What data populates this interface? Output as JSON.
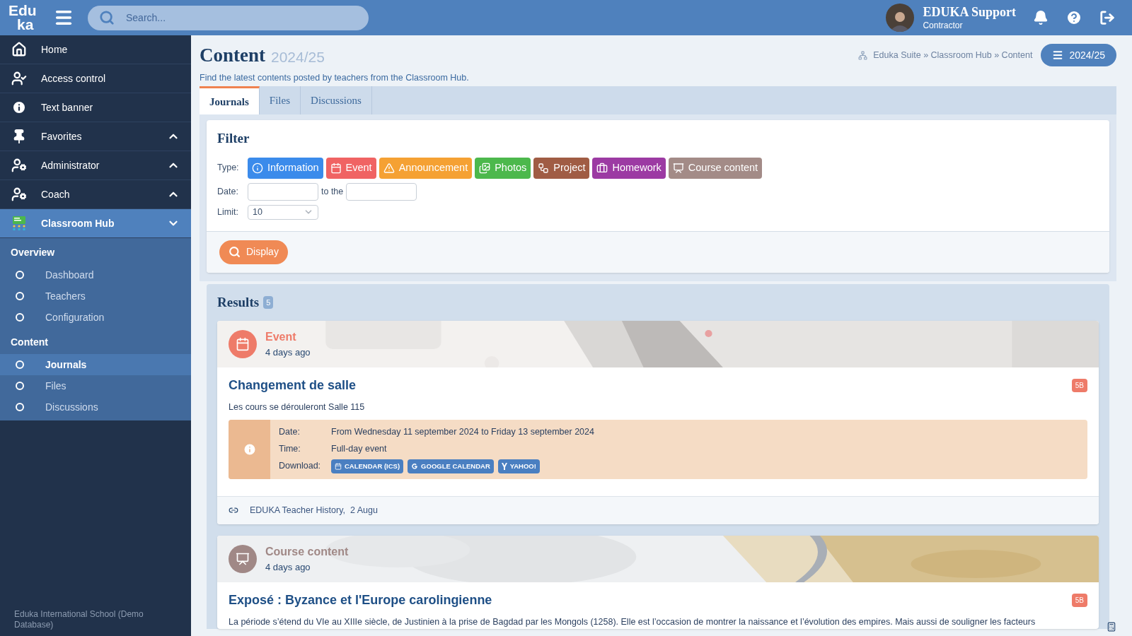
{
  "header": {
    "logo": [
      "Edu",
      "ka"
    ],
    "search": {
      "placeholder": "Search..."
    },
    "user": {
      "name": "EDUKA Support",
      "role": "Contractor"
    }
  },
  "sidebar": {
    "items": [
      {
        "kind": "link",
        "label": "Home",
        "selected": false
      },
      {
        "kind": "link",
        "label": "Access control",
        "selected": false
      },
      {
        "kind": "link",
        "label": "Text banner",
        "selected": false
      },
      {
        "kind": "group",
        "label": "Favorites",
        "expanded": false,
        "selected": false
      },
      {
        "kind": "group",
        "label": "Administrator",
        "expanded": false,
        "selected": false
      },
      {
        "kind": "group",
        "label": "Coach",
        "expanded": false,
        "selected": false
      },
      {
        "kind": "group",
        "label": "Classroom Hub",
        "expanded": true,
        "selected": true
      }
    ],
    "submenu": [
      {
        "heading": "Overview",
        "items": [
          {
            "label": "Dashboard",
            "selected": false
          },
          {
            "label": "Teachers",
            "selected": false
          },
          {
            "label": "Configuration",
            "selected": false
          }
        ]
      },
      {
        "heading": "Content",
        "items": [
          {
            "label": "Journals",
            "selected": true
          },
          {
            "label": "Files",
            "selected": false
          },
          {
            "label": "Discussions",
            "selected": false
          }
        ]
      }
    ],
    "footer": "Eduka International School (Demo Database)"
  },
  "page": {
    "title": "Content",
    "year": "2024/25",
    "breadcrumb": "Eduka Suite » Classroom Hub » Content",
    "year_button": "2024/25",
    "subtitle": "Find the latest contents posted by teachers from the Classroom Hub."
  },
  "tabs": [
    {
      "label": "Journals",
      "selected": true
    },
    {
      "label": "Files",
      "selected": false
    },
    {
      "label": "Discussions",
      "selected": false
    }
  ],
  "filter": {
    "title": "Filter",
    "type_label": "Type:",
    "types": [
      {
        "kind": "information",
        "label": "Information",
        "color": "#3b8beb"
      },
      {
        "kind": "event",
        "label": "Event",
        "color": "#f06363"
      },
      {
        "kind": "announcement",
        "label": "Announcement",
        "color": "#f5a133"
      },
      {
        "kind": "photos",
        "label": "Photos",
        "color": "#4cb84c"
      },
      {
        "kind": "project",
        "label": "Project",
        "color": "#a05c44"
      },
      {
        "kind": "homework",
        "label": "Homework",
        "color": "#9c3aa3"
      },
      {
        "kind": "course",
        "label": "Course content",
        "color": "#a38b87"
      }
    ],
    "date_label": "Date:",
    "to_label": "to the",
    "limit_label": "Limit:",
    "limit": "10",
    "button": "Display"
  },
  "results": {
    "title": "Results",
    "count": "5",
    "posts": [
      {
        "kind": "event",
        "type_label": "Event",
        "color": "#ee7b69",
        "time": "4 days ago",
        "title": "Changement de salle",
        "badge": "5B",
        "body": "Les cours se dérouleront Salle 115",
        "details": {
          "rows": [
            {
              "label": "Date:",
              "value": "From Wednesday 11 september 2024 to Friday 13 september 2024"
            },
            {
              "label": "Time:",
              "value": "Full-day event"
            }
          ],
          "download_label": "Download:",
          "downloads": [
            {
              "kind": "calendar",
              "label": "CALENDAR (ICS)"
            },
            {
              "kind": "google",
              "label": "GOOGLE CALENDAR"
            },
            {
              "kind": "yahoo",
              "label": "YAHOO!"
            }
          ]
        },
        "footer": "EDUKA Teacher History,  2 Augu"
      },
      {
        "kind": "course",
        "type_label": "Course content",
        "color": "#a08886",
        "time": "4 days ago",
        "title": "Exposé : Byzance et l'Europe carolingienne",
        "badge": "5B",
        "body": "La période s’étend du VIe au XIIIe siècle, de Justinien à la prise de Bagdad par les Mongols (1258). Elle est l’occasion de montrer la naissance et l’évolution des empires. Mais aussi de souligner les facteurs"
      }
    ]
  }
}
